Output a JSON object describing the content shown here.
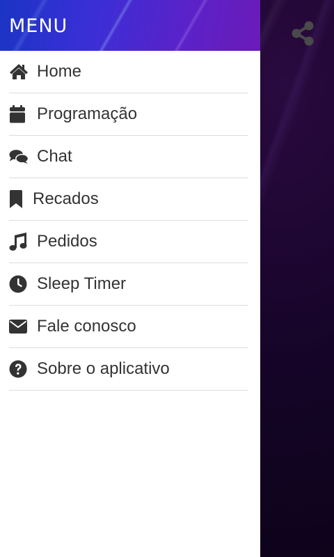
{
  "drawer": {
    "title": "MENU",
    "items": [
      {
        "label": "Home",
        "icon": "home-icon"
      },
      {
        "label": "Programação",
        "icon": "calendar-icon"
      },
      {
        "label": "Chat",
        "icon": "chat-icon"
      },
      {
        "label": "Recados",
        "icon": "bookmark-icon"
      },
      {
        "label": "Pedidos",
        "icon": "music-note-icon"
      },
      {
        "label": "Sleep Timer",
        "icon": "clock-icon"
      },
      {
        "label": "Fale conosco",
        "icon": "envelope-icon"
      },
      {
        "label": "Sobre o aplicativo",
        "icon": "question-circle-icon"
      }
    ]
  },
  "app": {
    "share_icon": "share-icon"
  },
  "colors": {
    "header_gradient_start": "#1b34c4",
    "header_gradient_end": "#6b1bb8",
    "icon": "#333333",
    "text": "#333333",
    "background_dark": "#0b0416",
    "share_icon": "#4a4a4a"
  }
}
